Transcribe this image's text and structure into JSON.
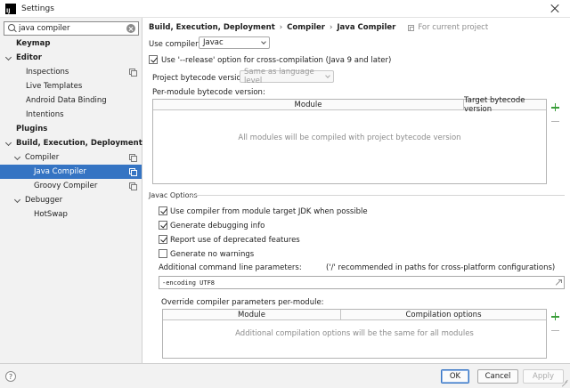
{
  "window": {
    "title": "Settings",
    "app_icon_text": "IJ"
  },
  "sidebar": {
    "search_value": "java compiler",
    "tree": [
      {
        "label": "Keymap",
        "bold": true,
        "indent": 0,
        "expandable": false,
        "copy": false,
        "selected": false
      },
      {
        "label": "Editor",
        "bold": true,
        "indent": 0,
        "expandable": true,
        "copy": false,
        "selected": false
      },
      {
        "label": "Inspections",
        "bold": false,
        "indent": 2,
        "expandable": false,
        "copy": true,
        "selected": false
      },
      {
        "label": "Live Templates",
        "bold": false,
        "indent": 2,
        "expandable": false,
        "copy": false,
        "selected": false
      },
      {
        "label": "Android Data Binding",
        "bold": false,
        "indent": 2,
        "expandable": false,
        "copy": false,
        "selected": false
      },
      {
        "label": "Intentions",
        "bold": false,
        "indent": 2,
        "expandable": false,
        "copy": false,
        "selected": false
      },
      {
        "label": "Plugins",
        "bold": true,
        "indent": 0,
        "expandable": false,
        "copy": false,
        "selected": false
      },
      {
        "label": "Build, Execution, Deployment",
        "bold": true,
        "indent": 0,
        "expandable": true,
        "copy": false,
        "selected": false
      },
      {
        "label": "Compiler",
        "bold": false,
        "indent": 1,
        "expandable": true,
        "copy": true,
        "selected": false
      },
      {
        "label": "Java Compiler",
        "bold": false,
        "indent": 3,
        "expandable": false,
        "copy": true,
        "selected": true
      },
      {
        "label": "Groovy Compiler",
        "bold": false,
        "indent": 3,
        "expandable": false,
        "copy": true,
        "selected": false
      },
      {
        "label": "Debugger",
        "bold": false,
        "indent": 1,
        "expandable": true,
        "copy": false,
        "selected": false
      },
      {
        "label": "HotSwap",
        "bold": false,
        "indent": 3,
        "expandable": false,
        "copy": false,
        "selected": false
      }
    ]
  },
  "breadcrumb": {
    "items": [
      "Build, Execution, Deployment",
      "Compiler",
      "Java Compiler"
    ],
    "separator": "›",
    "scope_label": "For current project"
  },
  "compiler": {
    "use_compiler_label": "Use compiler:",
    "use_compiler_value": "Javac",
    "release_option_label": "Use '--release' option for cross-compilation (Java 9 and later)",
    "release_option_checked": true,
    "project_bytecode_label": "Project bytecode version:",
    "project_bytecode_value": "Same as language level",
    "per_module_label": "Per-module bytecode version:",
    "module_table": {
      "col_module": "Module",
      "col_target": "Target bytecode version",
      "empty_text": "All modules will be compiled with project bytecode version"
    }
  },
  "javac": {
    "section_title": "Javac Options",
    "options": [
      {
        "label": "Use compiler from module target JDK when possible",
        "checked": true
      },
      {
        "label": "Generate debugging info",
        "checked": true
      },
      {
        "label": "Report use of deprecated features",
        "checked": true
      },
      {
        "label": "Generate no warnings",
        "checked": false
      }
    ],
    "cmd_params_label": "Additional command line parameters:",
    "cmd_params_hint": "('/' recommended in paths for cross-platform configurations)",
    "cmd_params_value": "-encoding UTF8",
    "override_label": "Override compiler parameters per-module:",
    "override_table": {
      "col_module": "Module",
      "col_options": "Compilation options",
      "empty_text": "Additional compilation options will be the same for all modules"
    }
  },
  "footer": {
    "help": "?",
    "ok": "OK",
    "cancel": "Cancel",
    "apply": "Apply"
  },
  "colors": {
    "selection": "#3574c3",
    "add_icon": "#3a9e3a"
  }
}
